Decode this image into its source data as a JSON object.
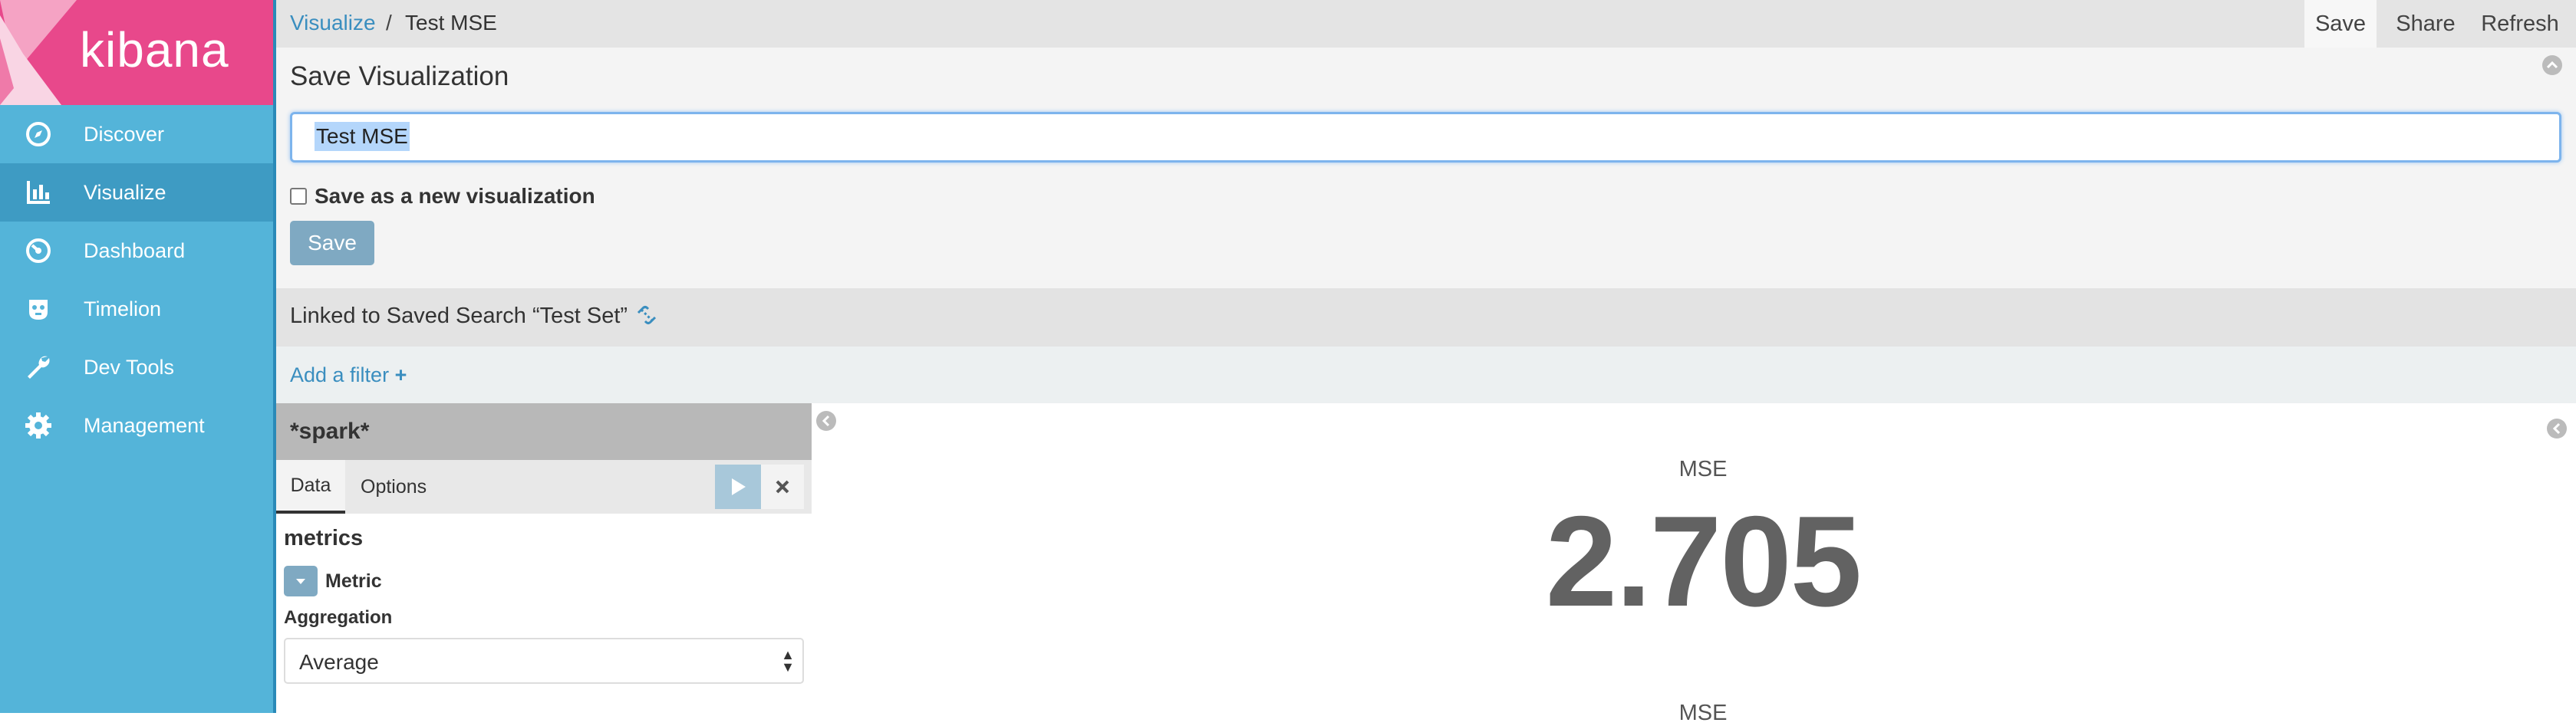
{
  "app": {
    "logo_text": "kibana"
  },
  "sidebar": {
    "items": [
      {
        "label": "Discover",
        "icon": "compass-icon",
        "active": false
      },
      {
        "label": "Visualize",
        "icon": "bar-chart-icon",
        "active": true
      },
      {
        "label": "Dashboard",
        "icon": "dashboard-icon",
        "active": false
      },
      {
        "label": "Timelion",
        "icon": "timelion-icon",
        "active": false
      },
      {
        "label": "Dev Tools",
        "icon": "wrench-icon",
        "active": false
      },
      {
        "label": "Management",
        "icon": "gear-icon",
        "active": false
      }
    ]
  },
  "breadcrumb": {
    "parent": "Visualize",
    "separator": "/",
    "current": "Test MSE"
  },
  "toolbar": {
    "save_label": "Save",
    "share_label": "Share",
    "refresh_label": "Refresh"
  },
  "save_panel": {
    "title": "Save Visualization",
    "input_value": "Test MSE",
    "checkbox_label": "Save as a new visualization",
    "checkbox_checked": false,
    "save_button_label": "Save"
  },
  "linked_search": {
    "text": "Linked to Saved Search “Test Set”"
  },
  "filter_bar": {
    "add_filter_label": "Add a filter",
    "add_icon": "+"
  },
  "editor": {
    "index_pattern": "*spark*",
    "tabs": [
      {
        "label": "Data",
        "active": true
      },
      {
        "label": "Options",
        "active": false
      }
    ],
    "section_title": "metrics",
    "metric_label": "Metric",
    "aggregation_label": "Aggregation",
    "aggregation_value": "Average"
  },
  "visualization": {
    "caption": "MSE",
    "value": "2.705",
    "caption_2": "MSE"
  },
  "colors": {
    "sidebar": "#54b4d9",
    "logo_bg": "#e8488b",
    "accent": "#3a8ebf",
    "button": "#7fa9c2"
  }
}
